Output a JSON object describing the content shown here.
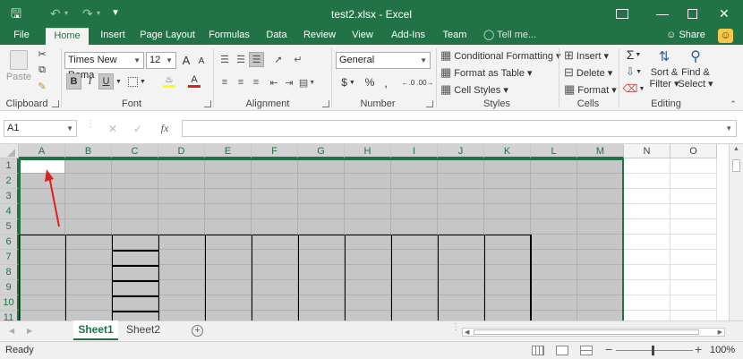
{
  "window": {
    "title": "test2.xlsx - Excel"
  },
  "colors": {
    "accent": "#217346",
    "selection": "#c6c6c6",
    "annotation": "#e0201c"
  },
  "tabs": [
    "File",
    "Home",
    "Insert",
    "Page Layout",
    "Formulas",
    "Data",
    "Review",
    "View",
    "Add-Ins",
    "Team"
  ],
  "active_tab": "Home",
  "tellme": "Tell me...",
  "share": "Share",
  "ribbon": {
    "clipboard": {
      "label": "Clipboard",
      "paste": "Paste"
    },
    "font": {
      "label": "Font",
      "name": "Times New Roma",
      "size": "12",
      "grow": "A",
      "shrink": "A",
      "bold": "B",
      "italic": "I",
      "underline": "U"
    },
    "alignment": {
      "label": "Alignment"
    },
    "number": {
      "label": "Number",
      "format": "General",
      "currency": "$",
      "percent": "%",
      "comma": ","
    },
    "styles": {
      "label": "Styles",
      "cond": "Conditional Formatting",
      "table": "Format as Table",
      "cell": "Cell Styles"
    },
    "cells": {
      "label": "Cells",
      "insert": "Insert",
      "delete": "Delete",
      "format": "Format"
    },
    "editing": {
      "label": "Editing",
      "sort1": "Sort &",
      "sort2": "Filter",
      "find1": "Find &",
      "find2": "Select"
    }
  },
  "formula_bar": {
    "name_box": "A1",
    "fx": "fx",
    "value": ""
  },
  "grid": {
    "columns": [
      "A",
      "B",
      "C",
      "D",
      "E",
      "F",
      "G",
      "H",
      "I",
      "J",
      "K",
      "L",
      "M",
      "N",
      "O"
    ],
    "rows": [
      "1",
      "2",
      "3",
      "4",
      "5",
      "6",
      "7",
      "8",
      "9",
      "10",
      "11"
    ]
  },
  "sheets": [
    "Sheet1",
    "Sheet2"
  ],
  "active_sheet": "Sheet1",
  "status": {
    "ready": "Ready",
    "zoom": "100%"
  }
}
